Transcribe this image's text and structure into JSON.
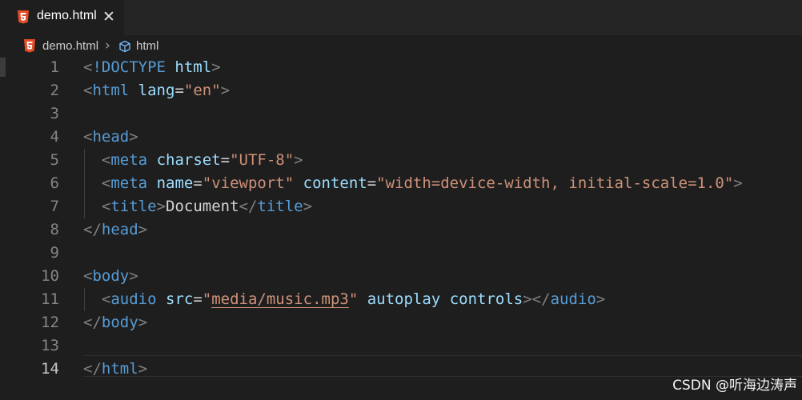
{
  "tab": {
    "filename": "demo.html",
    "close": "✕"
  },
  "breadcrumb": {
    "file": "demo.html",
    "separator": "›",
    "element": "html"
  },
  "gutter": [
    "1",
    "2",
    "3",
    "4",
    "5",
    "6",
    "7",
    "8",
    "9",
    "10",
    "11",
    "12",
    "13",
    "14"
  ],
  "active_line": "14",
  "code": {
    "l1": [
      "<",
      "!DOCTYPE",
      " ",
      "html",
      ">"
    ],
    "l2": [
      "<",
      "html",
      " ",
      "lang",
      "=",
      "\"en\"",
      ">"
    ],
    "l4": [
      "<",
      "head",
      ">"
    ],
    "l5": [
      "  ",
      "<",
      "meta",
      " ",
      "charset",
      "=",
      "\"UTF-8\"",
      ">"
    ],
    "l6": [
      "  ",
      "<",
      "meta",
      " ",
      "name",
      "=",
      "\"viewport\"",
      " ",
      "content",
      "=",
      "\"width=device-width, initial-scale=1.0\"",
      ">"
    ],
    "l7": [
      "  ",
      "<",
      "title",
      ">",
      "Document",
      "</",
      "title",
      ">"
    ],
    "l8": [
      "</",
      "head",
      ">"
    ],
    "l10": [
      "<",
      "body",
      ">"
    ],
    "l11": [
      "  ",
      "<",
      "audio",
      " ",
      "src",
      "=",
      "\"",
      "media/music.mp3",
      "\"",
      " ",
      "autoplay",
      " ",
      "controls",
      ">",
      "</",
      "audio",
      ">"
    ],
    "l12": [
      "</",
      "body",
      ">"
    ],
    "l14": [
      "</",
      "html",
      ">"
    ]
  },
  "watermark": "CSDN @听海边涛声",
  "colors": {
    "background": "#1e1e1e",
    "tag": "#569cd6",
    "attribute": "#9cdcfe",
    "string": "#ce9178",
    "punctuation": "#808080",
    "html5_icon": "#e44d26"
  },
  "icons": {
    "tab": "html5-icon",
    "breadcrumb_file": "html5-icon",
    "breadcrumb_element": "cube-icon"
  }
}
